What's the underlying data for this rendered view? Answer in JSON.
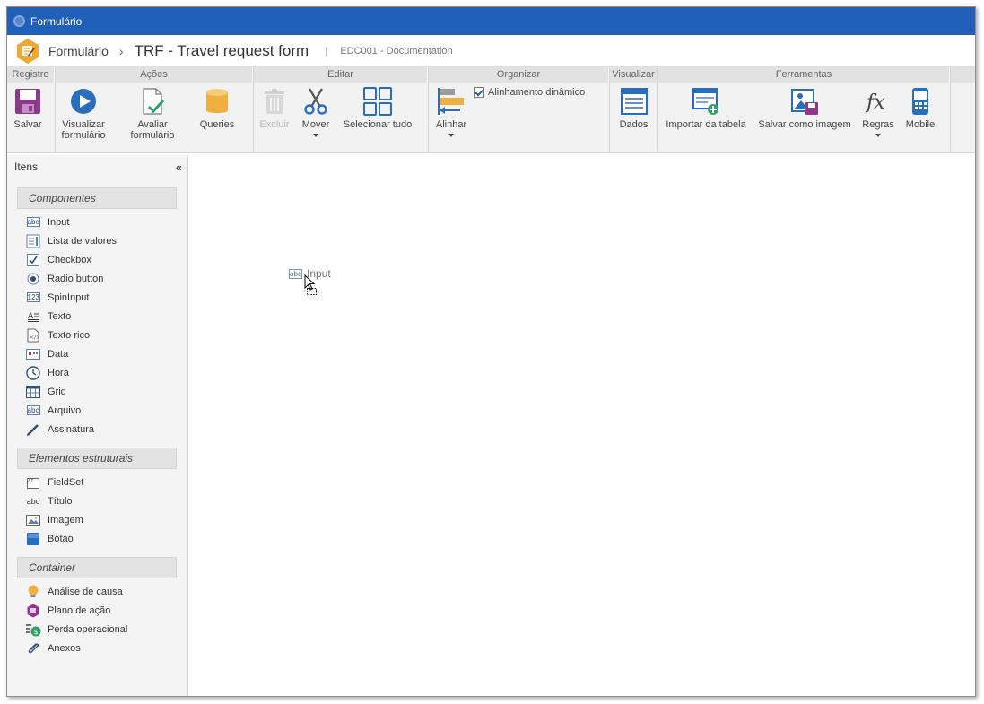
{
  "window": {
    "title": "Formulário"
  },
  "header": {
    "breadcrumb": "Formulário",
    "separator": "›",
    "title": "TRF - Travel request form",
    "divider": "|",
    "code": "EDC001 - Documentation"
  },
  "ribbon": {
    "groups": {
      "registro": "Registro",
      "acoes": "Ações",
      "editar": "Editar",
      "organizar": "Organizar",
      "visualizar": "Visualizar",
      "ferramentas": "Ferramentas"
    },
    "buttons": {
      "salvar": "Salvar",
      "visualizar_formulario": "Visualizar formulário",
      "avaliar_formulario": "Avaliar formulário",
      "queries": "Queries",
      "excluir": "Excluir",
      "mover": "Mover",
      "selecionar_tudo": "Selecionar tudo",
      "alinhar": "Alinhar",
      "alinhamento_dinamico": "Alinhamento dinâmico",
      "dados": "Dados",
      "importar_tabela": "Importar da tabela",
      "salvar_imagem": "Salvar como imagem",
      "regras": "Regras",
      "mobile": "Mobile"
    },
    "alinhamento_dinamico_checked": true,
    "excluir_disabled": true
  },
  "sidebar": {
    "title": "Itens",
    "collapse": "«",
    "sections": [
      {
        "title": "Componentes",
        "items": [
          {
            "label": "Input",
            "icon": "input-icon"
          },
          {
            "label": "Lista de valores",
            "icon": "list-values-icon"
          },
          {
            "label": "Checkbox",
            "icon": "checkbox-icon"
          },
          {
            "label": "Radio button",
            "icon": "radio-icon"
          },
          {
            "label": "SpinInput",
            "icon": "spin-input-icon"
          },
          {
            "label": "Texto",
            "icon": "text-icon"
          },
          {
            "label": "Texto rico",
            "icon": "rich-text-icon"
          },
          {
            "label": "Data",
            "icon": "date-icon"
          },
          {
            "label": "Hora",
            "icon": "clock-icon"
          },
          {
            "label": "Grid",
            "icon": "grid-icon"
          },
          {
            "label": "Arquivo",
            "icon": "file-input-icon"
          },
          {
            "label": "Assinatura",
            "icon": "signature-pen-icon"
          }
        ]
      },
      {
        "title": "Elementos estruturais",
        "items": [
          {
            "label": "FieldSet",
            "icon": "fieldset-icon"
          },
          {
            "label": "Título",
            "icon": "title-abc-icon"
          },
          {
            "label": "Imagem",
            "icon": "image-icon"
          },
          {
            "label": "Botão",
            "icon": "button-icon"
          }
        ]
      },
      {
        "title": "Container",
        "items": [
          {
            "label": "Análise de causa",
            "icon": "lightbulb-icon"
          },
          {
            "label": "Plano de ação",
            "icon": "action-plan-icon"
          },
          {
            "label": "Perda operacional",
            "icon": "money-loss-icon"
          },
          {
            "label": "Anexos",
            "icon": "paperclip-icon"
          }
        ]
      }
    ]
  },
  "canvas": {
    "dragged_item": {
      "label": "Input",
      "icon_text": "abc"
    }
  },
  "icons_text": {
    "abc": "abc",
    "spin": "123",
    "rich": "</>",
    "fieldset": "XY"
  },
  "colors": {
    "titlebar": "#2060b8",
    "accent": "#2b5fa5",
    "logo": "#f0a830"
  }
}
